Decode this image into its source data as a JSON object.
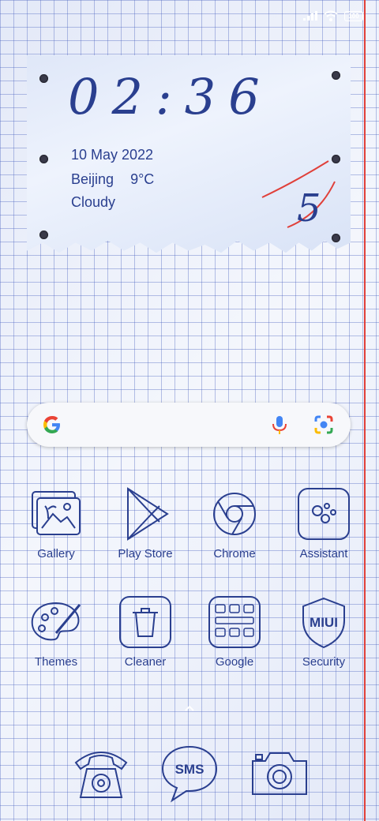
{
  "status_bar": {
    "battery": "100",
    "signal_icon": "signal-icon",
    "wifi_icon": "wifi-icon"
  },
  "clock_widget": {
    "time": "02:36",
    "date": "10 May 2022",
    "city": "Beijing",
    "temperature": "9°C",
    "condition": "Cloudy",
    "handwritten_mark": "5"
  },
  "search": {
    "google_icon": "google-g-icon",
    "mic_icon": "mic-icon",
    "lens_icon": "lens-icon"
  },
  "apps_row1": [
    {
      "label": "Gallery",
      "icon": "gallery-icon"
    },
    {
      "label": "Play Store",
      "icon": "play-store-icon"
    },
    {
      "label": "Chrome",
      "icon": "chrome-icon"
    },
    {
      "label": "Assistant",
      "icon": "assistant-icon"
    }
  ],
  "apps_row2": [
    {
      "label": "Themes",
      "icon": "themes-icon"
    },
    {
      "label": "Cleaner",
      "icon": "cleaner-icon"
    },
    {
      "label": "Google",
      "icon": "google-folder-icon"
    },
    {
      "label": "Security",
      "icon": "security-icon",
      "badge_text": "MIUI"
    }
  ],
  "dock": [
    {
      "icon": "phone-icon"
    },
    {
      "icon": "sms-icon",
      "text": "SMS"
    },
    {
      "icon": "camera-icon"
    }
  ],
  "colors": {
    "ink": "#2a3f8f",
    "margin_line": "#e0403a",
    "grid": "#465fbe"
  }
}
